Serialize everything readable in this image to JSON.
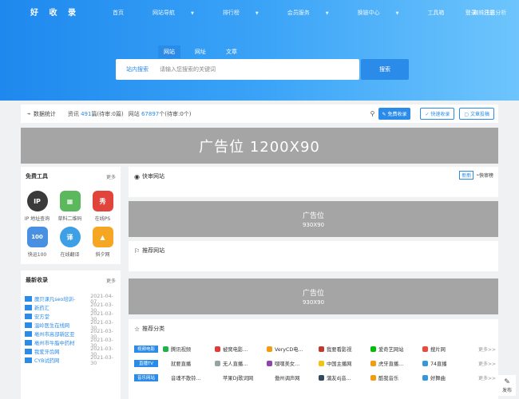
{
  "header": {
    "logo": "好 收 录",
    "nav": [
      {
        "label": "首页",
        "dropdown": false
      },
      {
        "label": "网站导航",
        "dropdown": true
      },
      {
        "label": "排行榜",
        "dropdown": true
      },
      {
        "label": "会员服务",
        "dropdown": true
      },
      {
        "label": "换链中心",
        "dropdown": true
      },
      {
        "label": "工具箱",
        "dropdown": false
      },
      {
        "label": "蜘蛛日志分析",
        "dropdown": false
      }
    ],
    "login": "登录",
    "register": "注册"
  },
  "search": {
    "tabs": [
      "网站",
      "网址",
      "文章"
    ],
    "active_tab": 0,
    "scope_label": "站内搜索",
    "placeholder": "请输入您搜索的关键词",
    "button": "搜索"
  },
  "stats": {
    "label": "数据统计",
    "news_prefix": "资讯",
    "news_count": "491",
    "news_suffix": "篇(待审:0篇)",
    "sites_prefix": "网站",
    "sites_count": "67897",
    "sites_suffix": "个(待审:0个)",
    "btn_free": "免费收录",
    "btn_fast": "快速收录",
    "btn_article": "文章投稿"
  },
  "banner": {
    "text": "广告位  1200X90"
  },
  "free_tools": {
    "title": "免费工具",
    "more": "更多",
    "items": [
      {
        "label": "IP 地址查询",
        "glyph": "IP",
        "color": "#3a3a3a",
        "icon": "ip-icon"
      },
      {
        "label": "草料二维码",
        "glyph": "▦",
        "color": "#5cb85c",
        "icon": "qrcode-icon"
      },
      {
        "label": "在线PS",
        "glyph": "秀",
        "color": "#e0443a",
        "icon": "ps-icon"
      },
      {
        "label": "快运100",
        "glyph": "100",
        "color": "#4a90e2",
        "icon": "express-icon"
      },
      {
        "label": "在线翻译",
        "glyph": "译",
        "color": "#3da0e6",
        "icon": "translate-icon"
      },
      {
        "label": "斜夕网",
        "glyph": "▲",
        "color": "#f5a623",
        "icon": "image-icon"
      }
    ]
  },
  "latest": {
    "title": "最新收录",
    "more": "更多",
    "items": [
      {
        "title": "魔贝课凡seo培训-",
        "date": "2021-04-07"
      },
      {
        "title": "新药汇",
        "date": "2021-03-30"
      },
      {
        "title": "安方堂",
        "date": "2021-03-30"
      },
      {
        "title": "温岭医生在线网",
        "date": "2021-03-30"
      },
      {
        "title": "亳州市高部新区亚",
        "date": "2021-03-30"
      },
      {
        "title": "亳州市牛脂中药材",
        "date": "2021-03-30"
      },
      {
        "title": "我爱牙齿网",
        "date": "2021-03-30"
      },
      {
        "title": "CYB试药网",
        "date": "2021-03-30"
      }
    ]
  },
  "quick_review": {
    "title": "快审网站",
    "badge": "新新",
    "rank": "快审榜"
  },
  "ad_930": {
    "line1": "广告位",
    "line2": "930X90"
  },
  "recommend": {
    "title": "推荐网站"
  },
  "categories": {
    "title": "推荐分类",
    "more": "更多>>",
    "rows": [
      {
        "badge": "视频电影",
        "items": [
          {
            "name": "腾讯视频",
            "color": "#21b14b"
          },
          {
            "name": "被窝电影...",
            "color": "#e03b3b"
          },
          {
            "name": "VeryCD电...",
            "color": "#f39c12"
          },
          {
            "name": "我要看影视",
            "color": "#c0392b"
          },
          {
            "name": "爱奇艺网站",
            "color": "#00be06"
          },
          {
            "name": "搜片网",
            "color": "#e74c3c"
          }
        ]
      },
      {
        "badge": "直播TV",
        "items": [
          {
            "name": "就要直播",
            "color": "#ffffff"
          },
          {
            "name": "无人直播...",
            "color": "#95a5a6"
          },
          {
            "name": "嘿嘿美女...",
            "color": "#8e44ad"
          },
          {
            "name": "中国主播网",
            "color": "#f1c40f"
          },
          {
            "name": "虎牙直播...",
            "color": "#f39c12"
          },
          {
            "name": "74直播",
            "color": "#3498db"
          }
        ]
      },
      {
        "badge": "音乐网站",
        "items": [
          {
            "name": "音魂不散铃...",
            "color": "#ffffff"
          },
          {
            "name": "苹果DJ歌词网",
            "color": "#ffffff"
          },
          {
            "name": "傲州调声网",
            "color": "#ffffff"
          },
          {
            "name": "蒲友dj音...",
            "color": "#34495e"
          },
          {
            "name": "酷我音乐",
            "color": "#f39c12"
          },
          {
            "name": "好舞曲",
            "color": "#3498db"
          }
        ]
      }
    ]
  },
  "float": {
    "write": "发布"
  }
}
